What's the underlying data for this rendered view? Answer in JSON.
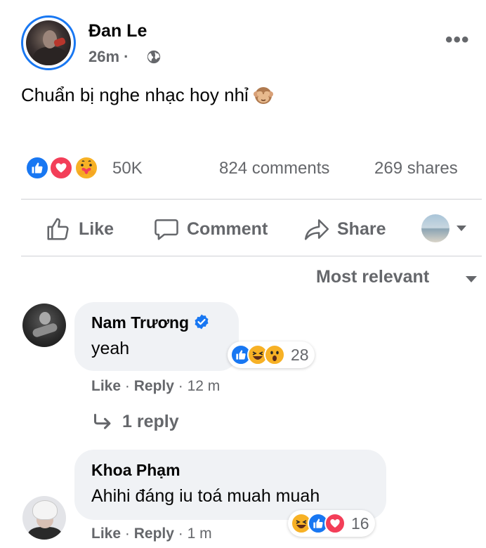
{
  "post": {
    "author": "Đan Le",
    "time": "26m",
    "separator": "·",
    "text": "Chuẩn bị nghe nhạc hoy nhỉ",
    "text_emoji": "see-no-evil-monkey",
    "more_icon": "•••"
  },
  "stats": {
    "reactions": [
      "like",
      "love",
      "care"
    ],
    "reaction_count": "50K",
    "comments": "824 comments",
    "shares": "269 shares"
  },
  "actions": {
    "like": "Like",
    "comment": "Comment",
    "share": "Share"
  },
  "sort": {
    "label": "Most relevant"
  },
  "comments": [
    {
      "name": "Nam Trương",
      "verified": true,
      "text": "yeah",
      "reactions": [
        "like",
        "haha",
        "wow"
      ],
      "reaction_count": "28",
      "like_label": "Like",
      "reply_label": "Reply",
      "dot": "·",
      "time": "12 m",
      "replies": "1 reply"
    },
    {
      "name": "Khoa Phạm",
      "verified": false,
      "text": "Ahihi đáng iu toá muah muah",
      "reactions": [
        "haha",
        "like",
        "love"
      ],
      "reaction_count": "16",
      "like_label": "Like",
      "reply_label": "Reply",
      "dot": "·",
      "time": "1 m"
    }
  ],
  "colors": {
    "accent": "#1877f2",
    "love": "#f33e58",
    "yellow": "#f7b125",
    "muted": "#65676b",
    "bubble": "#f0f2f5"
  }
}
